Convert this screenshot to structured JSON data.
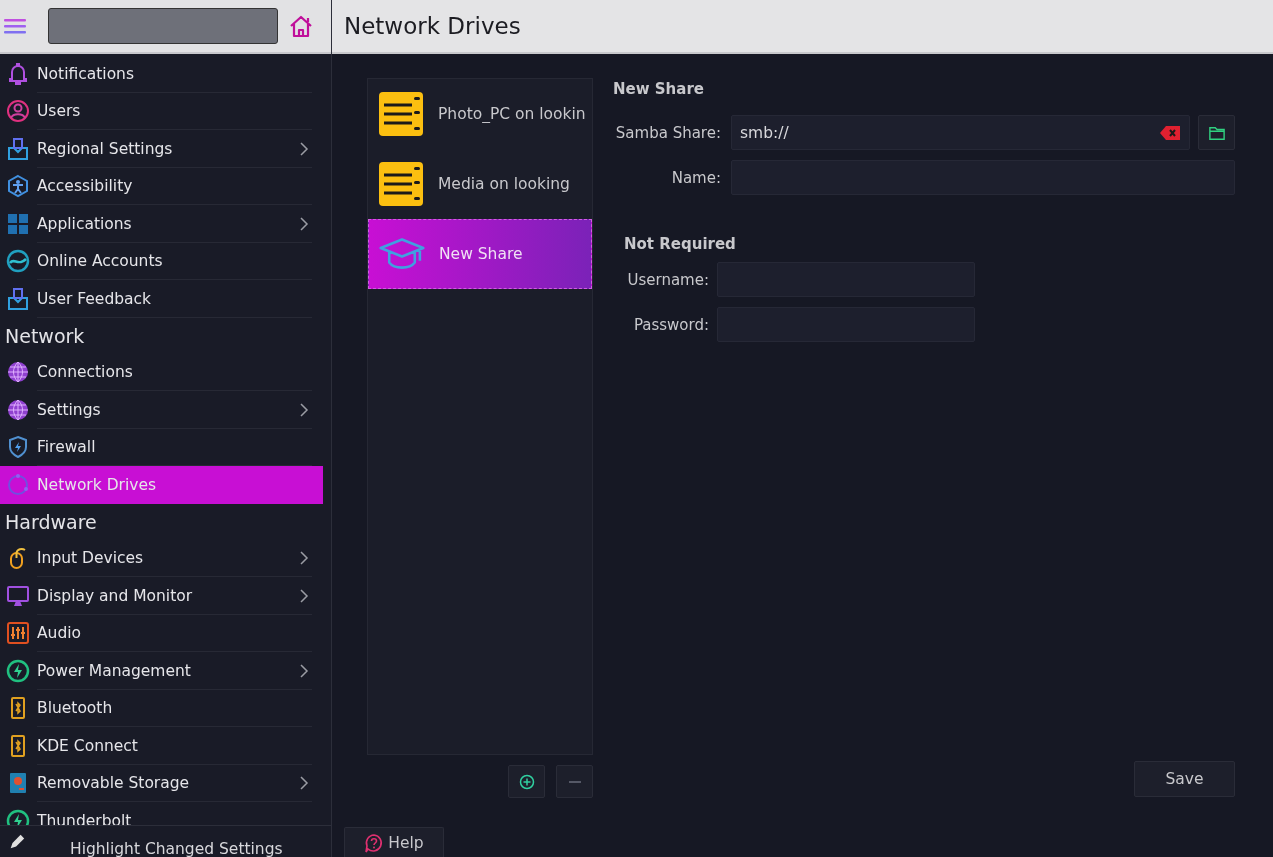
{
  "page_title": "Network Drives",
  "sidebar": {
    "sections": [
      {
        "items": [
          {
            "label": "Notifications",
            "has_submenu": false,
            "selected": false
          },
          {
            "label": "Users",
            "has_submenu": false,
            "selected": false
          },
          {
            "label": "Regional Settings",
            "has_submenu": true,
            "selected": false
          },
          {
            "label": "Accessibility",
            "has_submenu": false,
            "selected": false
          },
          {
            "label": "Applications",
            "has_submenu": true,
            "selected": false
          },
          {
            "label": "Online Accounts",
            "has_submenu": false,
            "selected": false
          },
          {
            "label": "User Feedback",
            "has_submenu": false,
            "selected": false
          }
        ]
      },
      {
        "heading": "Network",
        "items": [
          {
            "label": "Connections",
            "has_submenu": false,
            "selected": false
          },
          {
            "label": "Settings",
            "has_submenu": true,
            "selected": false
          },
          {
            "label": "Firewall",
            "has_submenu": false,
            "selected": false
          },
          {
            "label": "Network Drives",
            "has_submenu": false,
            "selected": true
          }
        ]
      },
      {
        "heading": "Hardware",
        "items": [
          {
            "label": "Input Devices",
            "has_submenu": true,
            "selected": false
          },
          {
            "label": "Display and Monitor",
            "has_submenu": true,
            "selected": false
          },
          {
            "label": "Audio",
            "has_submenu": false,
            "selected": false
          },
          {
            "label": "Power Management",
            "has_submenu": true,
            "selected": false
          },
          {
            "label": "Bluetooth",
            "has_submenu": false,
            "selected": false
          },
          {
            "label": "KDE Connect",
            "has_submenu": false,
            "selected": false
          },
          {
            "label": "Removable Storage",
            "has_submenu": true,
            "selected": false
          },
          {
            "label": "Thunderbolt",
            "has_submenu": false,
            "selected": false
          }
        ]
      }
    ],
    "footer": "Highlight Changed Settings"
  },
  "shares": [
    {
      "kind": "drive",
      "label": "Photo_PC on lookin",
      "selected": false
    },
    {
      "kind": "drive",
      "label": "Media on looking",
      "selected": false
    },
    {
      "kind": "new",
      "label": "New Share",
      "selected": true
    }
  ],
  "form": {
    "heading": "New Share",
    "fields": [
      {
        "label": "Samba Share:",
        "value": "smb://"
      },
      {
        "label": "Name:"
      }
    ],
    "optional_heading": "Not Required",
    "optional_fields": [
      {
        "label": "Username:"
      },
      {
        "label": "Password:"
      }
    ]
  },
  "save": "Save",
  "help": "Help"
}
